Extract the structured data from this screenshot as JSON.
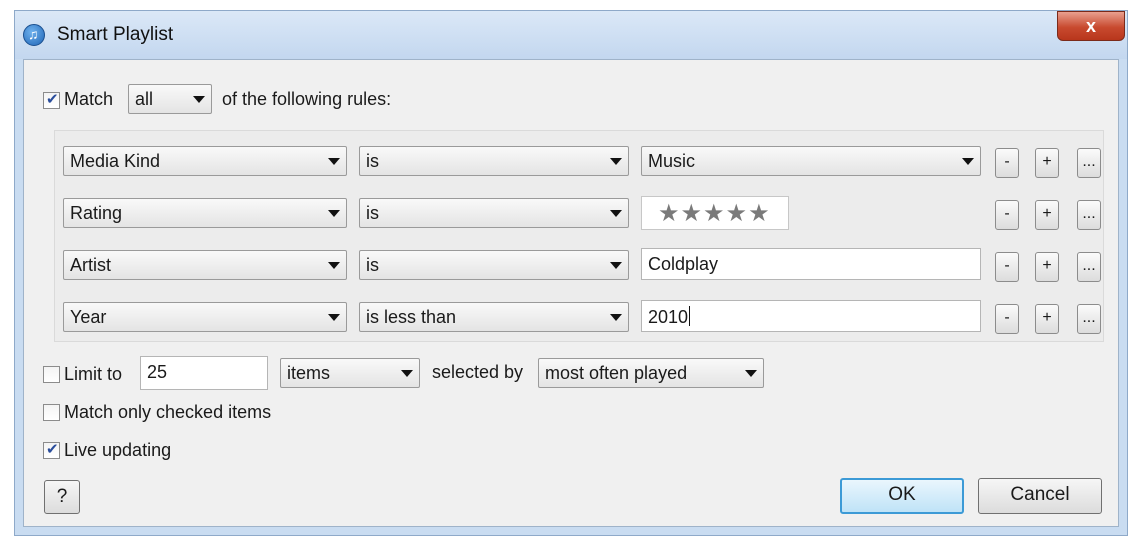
{
  "window": {
    "title": "Smart Playlist",
    "close_glyph": "x"
  },
  "match": {
    "label": "Match",
    "checked": true,
    "mode": "all",
    "suffix": "of the following rules:"
  },
  "rules": [
    {
      "field": "Media Kind",
      "op": "is",
      "value": "Music",
      "value_type": "dropdown"
    },
    {
      "field": "Rating",
      "op": "is",
      "value": "★★★★★",
      "value_type": "stars",
      "rating": 5
    },
    {
      "field": "Artist",
      "op": "is",
      "value": "Coldplay",
      "value_type": "text"
    },
    {
      "field": "Year",
      "op": "is less than",
      "value": "2010",
      "value_type": "text"
    }
  ],
  "rule_buttons": {
    "remove": "-",
    "add": "+",
    "more": "..."
  },
  "limit": {
    "label": "Limit to",
    "checked": false,
    "value": "25",
    "unit": "items",
    "selected_by_label": "selected by",
    "selected_by": "most often played"
  },
  "match_checked": {
    "label": "Match only checked items",
    "checked": false
  },
  "live_updating": {
    "label": "Live updating",
    "checked": true
  },
  "buttons": {
    "help": "?",
    "ok": "OK",
    "cancel": "Cancel"
  },
  "icons": {
    "app": "itunes-icon",
    "close": "close-icon",
    "dropdown": "chevron-down-icon"
  }
}
